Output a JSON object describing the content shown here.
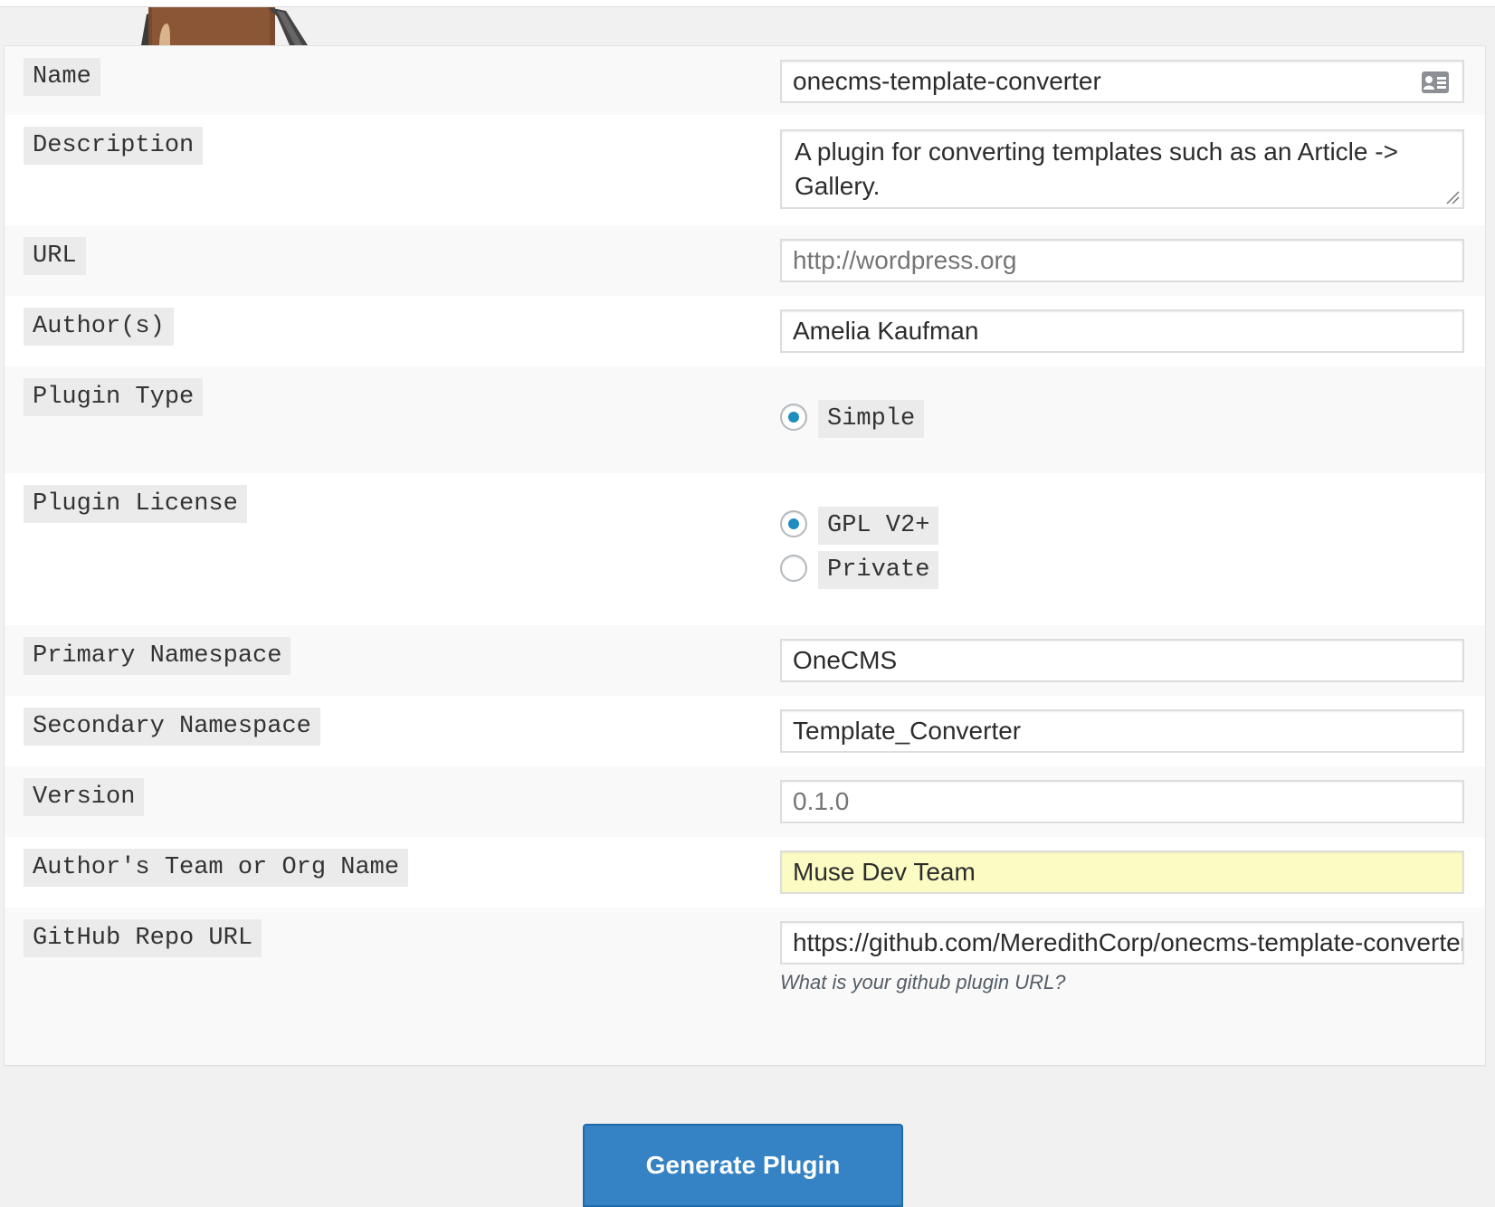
{
  "form": {
    "fields": {
      "name": {
        "label": "Name",
        "value": "onecms-template-converter"
      },
      "description": {
        "label": "Description",
        "value": "A plugin for converting templates such as an Article -> Gallery."
      },
      "url": {
        "label": "URL",
        "placeholder": "http://wordpress.org"
      },
      "authors": {
        "label": "Author(s)",
        "value": "Amelia Kaufman"
      },
      "plugin_type": {
        "label": "Plugin Type",
        "options": [
          {
            "label": "Simple",
            "checked": true
          }
        ]
      },
      "plugin_license": {
        "label": "Plugin License",
        "options": [
          {
            "label": "GPL V2+",
            "checked": true
          },
          {
            "label": "Private",
            "checked": false
          }
        ]
      },
      "primary_namespace": {
        "label": "Primary Namespace",
        "value": "OneCMS"
      },
      "secondary_namespace": {
        "label": "Secondary Namespace",
        "value": "Template_Converter"
      },
      "version": {
        "label": "Version",
        "placeholder": "0.1.0"
      },
      "team": {
        "label": "Author's Team or Org Name",
        "value": "Muse Dev Team"
      },
      "github": {
        "label": "GitHub Repo URL",
        "value": "https://github.com/MeredithCorp/onecms-template-converter",
        "hint": "What is your github plugin URL?"
      }
    },
    "submit_label": "Generate Plugin"
  },
  "colors": {
    "button_primary": "#3582c4",
    "radio_checked": "#1e8cbe",
    "autofill_highlight": "#fbfcc4",
    "row_alternate": "#f9f9f9",
    "label_background": "#ebebeb"
  },
  "icons": {
    "name_field": "contact-card-icon",
    "description_field": "resize-grip-icon",
    "header": "mascot-illustration"
  }
}
